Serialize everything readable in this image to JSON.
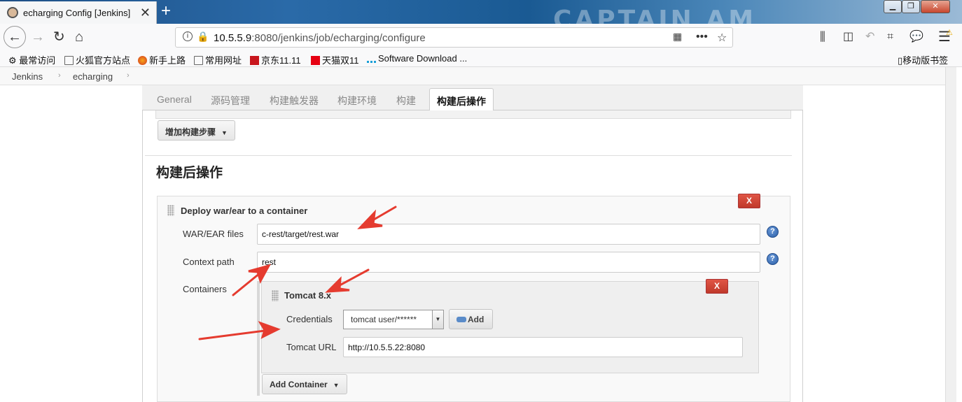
{
  "browser": {
    "tab_title": "echarging Config [Jenkins]",
    "tab_close": "✕",
    "new_tab": "+",
    "window_buttons": {
      "minimize": "▁",
      "maximize": "❐",
      "close": "✕"
    },
    "url_host": "10.5.5.9",
    "url_rest": ":8080/jenkins/job/echarging/configure",
    "bookmarks": [
      {
        "label": "最常访问",
        "icon": "gear-icon"
      },
      {
        "label": "火狐官方站点",
        "icon": "folder-icon"
      },
      {
        "label": "新手上路",
        "icon": "firefox-icon"
      },
      {
        "label": "常用网址",
        "icon": "folder-icon"
      },
      {
        "label": "京东11.11",
        "icon": "jd-icon"
      },
      {
        "label": "天猫双11",
        "icon": "tmall-icon"
      },
      {
        "label": "Software Download ...",
        "icon": "cisco-icon"
      }
    ],
    "mobile_bookmarks": "移动版书签",
    "colors": {
      "accent": "#1d4f86",
      "danger": "#c0392b",
      "arrow": "#e53b2f"
    }
  },
  "breadcrumb": [
    "Jenkins",
    "echarging"
  ],
  "config_tabs": [
    "General",
    "源码管理",
    "构建触发器",
    "构建环境",
    "构建",
    "构建后操作"
  ],
  "active_tab": "构建后操作",
  "add_build_step": "增加构建步骤",
  "section_title": "构建后操作",
  "deploy": {
    "title": "Deploy war/ear to a container",
    "remove": "X",
    "war_label": "WAR/EAR files",
    "war_value": "c-rest/target/rest.war",
    "context_label": "Context path",
    "context_value": "rest",
    "containers_label": "Containers",
    "help": "?"
  },
  "tomcat": {
    "title": "Tomcat 8.x",
    "remove": "X",
    "credentials_label": "Credentials",
    "credentials_value": "tomcat  user/******",
    "add_label": "Add",
    "url_label": "Tomcat URL",
    "url_value": "http://10.5.5.22:8080"
  },
  "add_container": "Add Container"
}
